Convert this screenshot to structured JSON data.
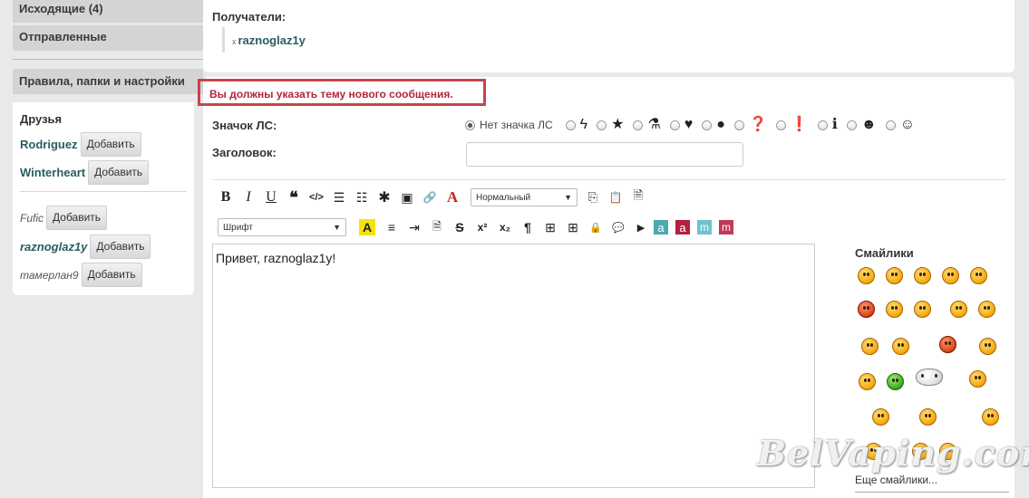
{
  "sidebar": {
    "folders": [
      {
        "label": "Исходящие (4)"
      },
      {
        "label": "Отправленные"
      }
    ],
    "rules_label": "Правила, папки и настройки",
    "friends_title": "Друзья",
    "add_label": "Добавить",
    "friends": [
      {
        "name": "Rodriguez"
      },
      {
        "name": "Winterheart"
      }
    ],
    "others": [
      {
        "name": "Fufic"
      },
      {
        "name": "raznoglaz1y"
      },
      {
        "name": "тамерлан9"
      }
    ]
  },
  "recipients": {
    "label": "Получатели:",
    "remove_glyph": "x",
    "name": "raznoglaz1y"
  },
  "form": {
    "error": "Вы должны указать тему нового сообщения.",
    "icon_label": "Значок ЛС:",
    "no_icon": "Нет значка ЛС",
    "icons": [
      "bolt-icon",
      "star-icon",
      "flask-icon",
      "heart-icon",
      "speech-bubble-icon",
      "question-icon",
      "exclamation-icon",
      "info-icon",
      "grin-icon",
      "smile-icon"
    ],
    "title_label": "Заголовок:",
    "title_value": ""
  },
  "toolbar": {
    "size_select": "Нормальный",
    "font_select": "Шрифт",
    "row1_glyphs": [
      "B",
      "I",
      "U",
      "❝",
      "</>",
      "☰",
      "☷",
      "✱",
      "▣",
      "🔗",
      "A"
    ],
    "row1_right": [
      "⎘",
      "📋",
      "🗎"
    ],
    "row2_glyphs": [
      "A",
      "≡",
      "⇥",
      "🗎",
      "S",
      "x²",
      "x₂",
      "¶",
      "⊞",
      "⊞",
      "🔒",
      "💬",
      "▶",
      "a",
      "a",
      "m",
      "m"
    ],
    "badge_colors": [
      "#4aa8b0",
      "#b5203e",
      "#6fc1cf",
      "#c0395a"
    ]
  },
  "editor": {
    "text": "Привет, raznoglaz1y!"
  },
  "smilies": {
    "title": "Смайлики",
    "more": "Еще смайлики..."
  },
  "watermark": "BelVaping.com"
}
